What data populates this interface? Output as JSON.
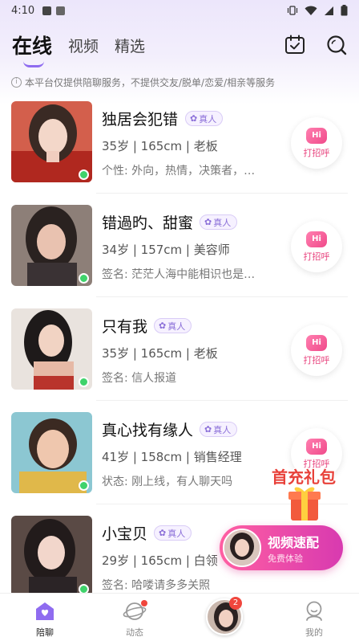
{
  "status_bar": {
    "time": "4:10"
  },
  "header": {
    "tabs": [
      {
        "label": "在线",
        "active": true
      },
      {
        "label": "视频",
        "active": false
      },
      {
        "label": "精选",
        "active": false
      }
    ],
    "icons": [
      "calendar-check-icon",
      "search-icon"
    ]
  },
  "notice": "本平台仅提供陪聊服务，不提供交友/脱单/恋爱/相亲等服务",
  "verify_label": "真人",
  "greet_button": {
    "hi": "Hi",
    "label": "打招呼"
  },
  "users": [
    {
      "name": "独居会犯错",
      "meta": "35岁 | 165cm | 老板",
      "bio": "个性: 外向，热情，决策者，…",
      "online": true
    },
    {
      "name": "错過旳、甜蜜",
      "meta": "34岁 | 157cm | 美容师",
      "bio": "签名: 茫茫人海中能相识也是…",
      "online": true
    },
    {
      "name": "只有我",
      "meta": "35岁 | 165cm | 老板",
      "bio": "签名: 信人报道",
      "online": true
    },
    {
      "name": "真心找有缘人",
      "meta": "41岁 | 158cm | 销售经理",
      "bio": "状态: 刚上线，有人聊天吗",
      "online": true
    },
    {
      "name": "小宝贝",
      "meta": "29岁 | 165cm | 白领",
      "bio": "签名: 哈喽请多多关照",
      "online": true
    }
  ],
  "promo": {
    "gift_text": "首充礼包"
  },
  "video_match": {
    "title": "视频速配",
    "subtitle": "免费体验"
  },
  "bottom_nav": [
    {
      "label": "陪聊",
      "icon": "heart-home-icon",
      "active": true
    },
    {
      "label": "动态",
      "icon": "planet-icon",
      "active": false,
      "dot": true
    },
    {
      "label": "",
      "icon": "avatar-icon",
      "active": false,
      "badge": "2"
    },
    {
      "label": "我的",
      "icon": "profile-icon",
      "active": false
    }
  ],
  "colors": {
    "accent": "#8f6cf0",
    "pink": "#e8457f",
    "online": "#3fd36b",
    "badge": "#f0463d"
  }
}
